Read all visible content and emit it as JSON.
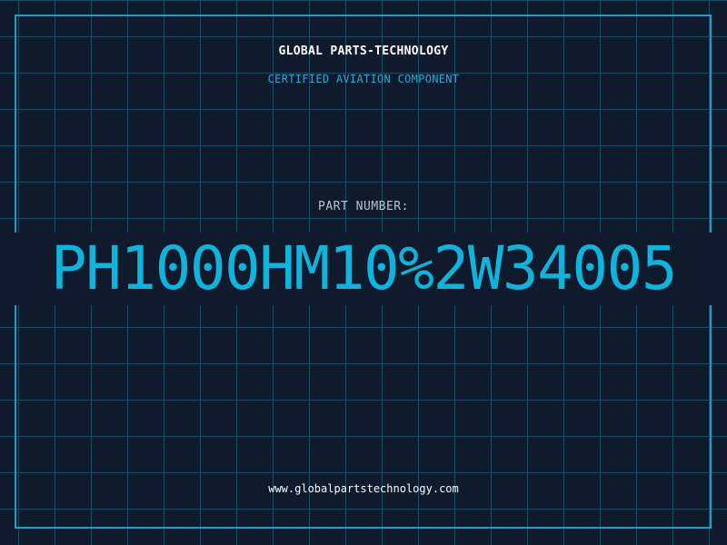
{
  "header": {
    "company": "GLOBAL PARTS-TECHNOLOGY",
    "subtitle": "CERTIFIED AVIATION COMPONENT"
  },
  "part": {
    "label": "PART NUMBER:",
    "number": "PH1000HM10%2W34005"
  },
  "footer": {
    "website": "www.globalpartstechnology.com"
  },
  "colors": {
    "background": "#0f1a2d",
    "grid": "#1c4b63",
    "frame": "#1aa0c8",
    "accent": "#0fb3dc"
  }
}
